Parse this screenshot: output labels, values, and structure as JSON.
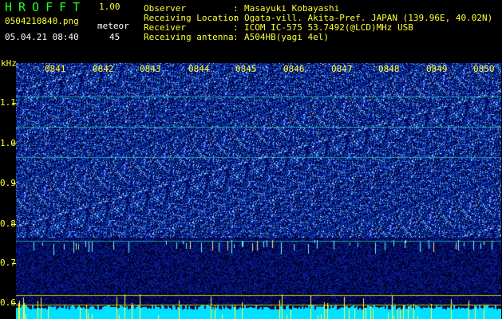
{
  "header": {
    "app_name": "HROFFT",
    "version": "1.00",
    "filename": "0504210840.png",
    "datetime": "05.04.21 08:40",
    "meteor_label": "meteor",
    "meteor_count": "45"
  },
  "meta": [
    {
      "key": "Observer",
      "sep": ":",
      "value": "Masayuki Kobayashi"
    },
    {
      "key": "Receiving Location",
      "sep": ":",
      "value": "Ogata-vill. Akita-Pref. JAPAN (139.96E, 40.02N)"
    },
    {
      "key": "Receiver",
      "sep": ":",
      "value": "ICOM IC-575 53.7492(@LCD)MHz USB"
    },
    {
      "key": "Receiving antenna",
      "sep": ":",
      "value": "A504HB(yagi 4el)"
    }
  ],
  "axis": {
    "y_unit": "kHz",
    "y_ticks": [
      "1.1",
      "1.0",
      "0.9",
      "0.8",
      "0.7",
      "0.6"
    ],
    "x_ticks": [
      "0841",
      "0842",
      "0843",
      "0844",
      "0845",
      "0846",
      "0847",
      "0848",
      "0849",
      "0850"
    ]
  },
  "colors": {
    "title_green": "#22ff22",
    "label_yellow": "#ffff33",
    "background": "#000000",
    "spectrum_blue": "#1020c0",
    "baseline_cyan": "#00e0ff"
  }
}
